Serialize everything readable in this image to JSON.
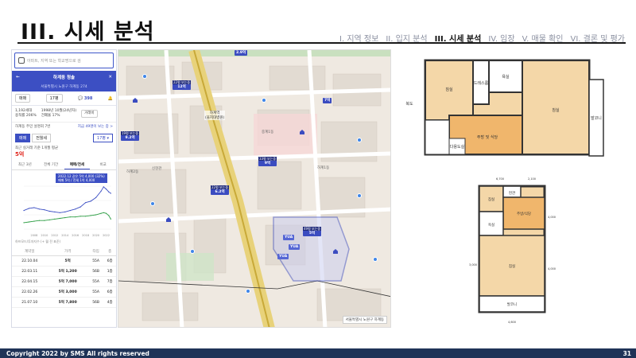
{
  "page": {
    "title": "III. 시세 분석",
    "nav": [
      {
        "label": "I. 지역 정보",
        "active": false
      },
      {
        "label": "II. 입지 분석",
        "active": false
      },
      {
        "label": "III. 시세 분석",
        "active": true
      },
      {
        "label": "IV. 임장",
        "active": false
      },
      {
        "label": "V. 매물 확인",
        "active": false
      },
      {
        "label": "VI. 결론 및 평가",
        "active": false
      }
    ],
    "footer": "Copyright 2022 by SMS All rights reserved",
    "page_number": "31"
  },
  "app": {
    "search_placeholder": "아파트, 지역 또는 학교명으로 검",
    "header_title": "하계동 청솔",
    "address": "서울특별시 노원구 하계동 274",
    "trade_type": "매매",
    "area": "17평",
    "view_count": "398",
    "info_left": [
      "1,192세대",
      "용적률 206%"
    ],
    "info_right": [
      "1998년 10월(24년차)",
      "건폐율 17%"
    ],
    "compare_button": "거래비",
    "nearby_text": "하계동 주민 설명회 7번",
    "nearby_link": "지금 49명이 보는 중 >",
    "toggle_sale": "매매",
    "toggle_jeonse": "전월세",
    "area_select": "17평 ▾",
    "recent_label": "최근 실거래 기준 1개월 평균",
    "recent_price": "5억",
    "tabs": [
      "최근 3년",
      "전체 기간",
      "매매/전세",
      "비교"
    ],
    "tooltip_lines": [
      "2022.12 같은 5억 4,000 (32%)",
      "매매 5억 / 전세 1억 4,000"
    ],
    "chart_caption": "하프모드/투자지수 (+ 월 전 표준)",
    "chart_x_labels": [
      "2008",
      "2010",
      "2012",
      "2014",
      "2016",
      "2018",
      "2020",
      "2022"
    ],
    "deals": {
      "headers": [
        "계약일",
        "가격",
        "타입",
        "층"
      ],
      "rows": [
        [
          "22.10.04",
          "5억",
          "55A",
          "6층"
        ],
        [
          "22.03.11",
          "5억 1,200",
          "56B",
          "1층"
        ],
        [
          "22.04.15",
          "5억 7,000",
          "55A",
          "7층"
        ],
        [
          "22.02.26",
          "5억 3,000",
          "55A",
          "6층"
        ],
        [
          "21.07.10",
          "5억 7,800",
          "56B",
          "4층"
        ]
      ]
    }
  },
  "chart_data": {
    "type": "line",
    "xlim": [
      2006,
      2023
    ],
    "ylim": [
      0,
      6
    ],
    "x": [
      2006,
      2007,
      2008,
      2009,
      2010,
      2011,
      2012,
      2013,
      2014,
      2015,
      2016,
      2017,
      2018,
      2019,
      2020,
      2021,
      2021.5,
      2022,
      2022.5,
      2022.9
    ],
    "series": [
      {
        "values": [
          2.6,
          2.9,
          3.0,
          2.8,
          2.7,
          2.5,
          2.4,
          2.3,
          2.4,
          2.6,
          2.8,
          3.1,
          3.7,
          3.9,
          4.4,
          5.3,
          5.9,
          5.6,
          5.2,
          5.0
        ],
        "color": "#3c4fc3"
      },
      {
        "values": [
          0.9,
          1.0,
          1.1,
          1.2,
          1.2,
          1.3,
          1.4,
          1.5,
          1.6,
          1.7,
          1.7,
          1.8,
          1.8,
          1.9,
          2.0,
          2.2,
          2.3,
          2.2,
          1.9,
          1.4
        ],
        "color": "#2e9e45"
      }
    ]
  },
  "map": {
    "markers": [
      {
        "top": "2.9억",
        "price": ""
      },
      {
        "top": "22평 보는중",
        "price": "12억"
      },
      {
        "top": "",
        "price": "7억"
      },
      {
        "top": "19평 보는중",
        "price": "9.2억"
      },
      {
        "top": "33평 보는중",
        "price": "9억"
      },
      {
        "top": "22평 보는중",
        "price": "6.2억"
      },
      {
        "top": "49평 보는중",
        "price": "5억"
      }
    ],
    "labels": [
      "하계2동",
      "신현관",
      "하계1동",
      "하계역",
      "(을지대병원)",
      "중계1동"
    ],
    "clusters": [
      "YUA",
      "YUA",
      "YUA"
    ],
    "scale_text": "서울특별시 노원구 하계동"
  },
  "plans": {
    "plan1": {
      "rooms": [
        "침실",
        "드레스룸",
        "주방 및 식당",
        "침실",
        "발코니",
        "욕실",
        "다용도실"
      ],
      "side_label": "복도"
    },
    "plan2": {
      "rooms": [
        "현관",
        "침실",
        "주방/식당",
        "욕실",
        "침실",
        "발코니"
      ],
      "dims": [
        "6,700",
        "2,100",
        "4,000",
        "4,000",
        "4,600",
        "3,000"
      ]
    }
  }
}
